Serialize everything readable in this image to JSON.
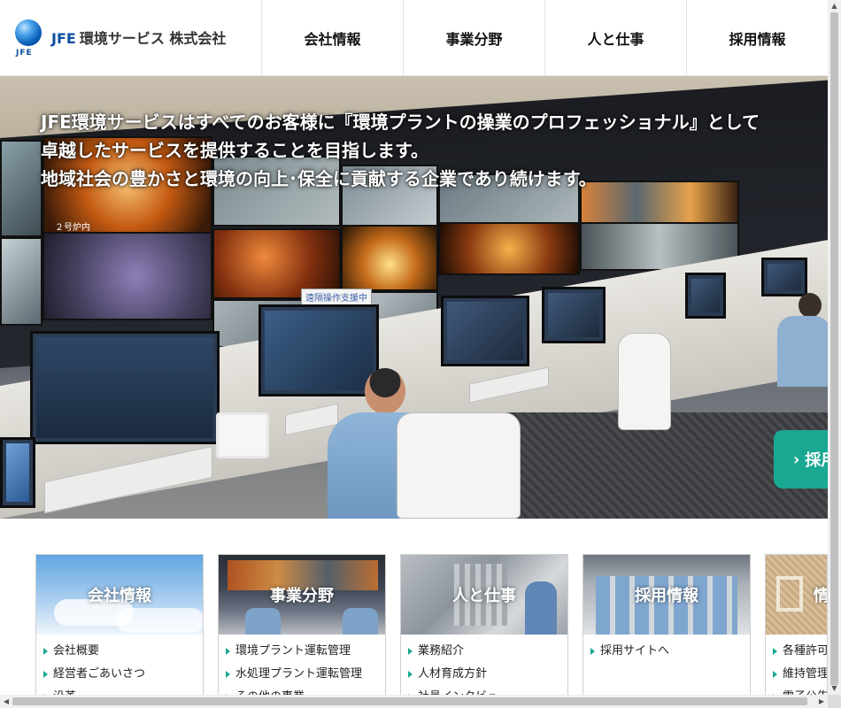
{
  "header": {
    "logo_mark": "JFE",
    "company_prefix": "JFE",
    "company_name": "環境サービス 株式会社",
    "nav": [
      {
        "label": "会社情報"
      },
      {
        "label": "事業分野"
      },
      {
        "label": "人と仕事"
      },
      {
        "label": "採用情報"
      }
    ]
  },
  "hero": {
    "lines": [
      "JFE環境サービスはすべてのお客様に『環境プラントの操業のプロフェッショナル』として",
      "卓越したサービスを提供することを目指します。",
      "地域社会の豊かさと環境の向上･保全に貢献する企業であり続けます。"
    ],
    "recruit_button": "採用",
    "screen_label_1": "２号炉内",
    "screen_label_2": "遠隔操作支援中"
  },
  "cards": [
    {
      "title": "会社情報",
      "links": [
        "会社概要",
        "経営者ごあいさつ",
        "沿革"
      ]
    },
    {
      "title": "事業分野",
      "links": [
        "環境プラント運転管理",
        "水処理プラント運転管理",
        "その他の事業"
      ]
    },
    {
      "title": "人と仕事",
      "links": [
        "業務紹介",
        "人材育成方針",
        "社員インタビュー"
      ]
    },
    {
      "title": "採用情報",
      "links": [
        "採用サイトへ"
      ]
    },
    {
      "title": "情",
      "links": [
        "各種許可",
        "維持管理",
        "電子公告"
      ]
    }
  ],
  "colors": {
    "accent": "#1aa893",
    "brand_blue": "#0a4fa0"
  }
}
